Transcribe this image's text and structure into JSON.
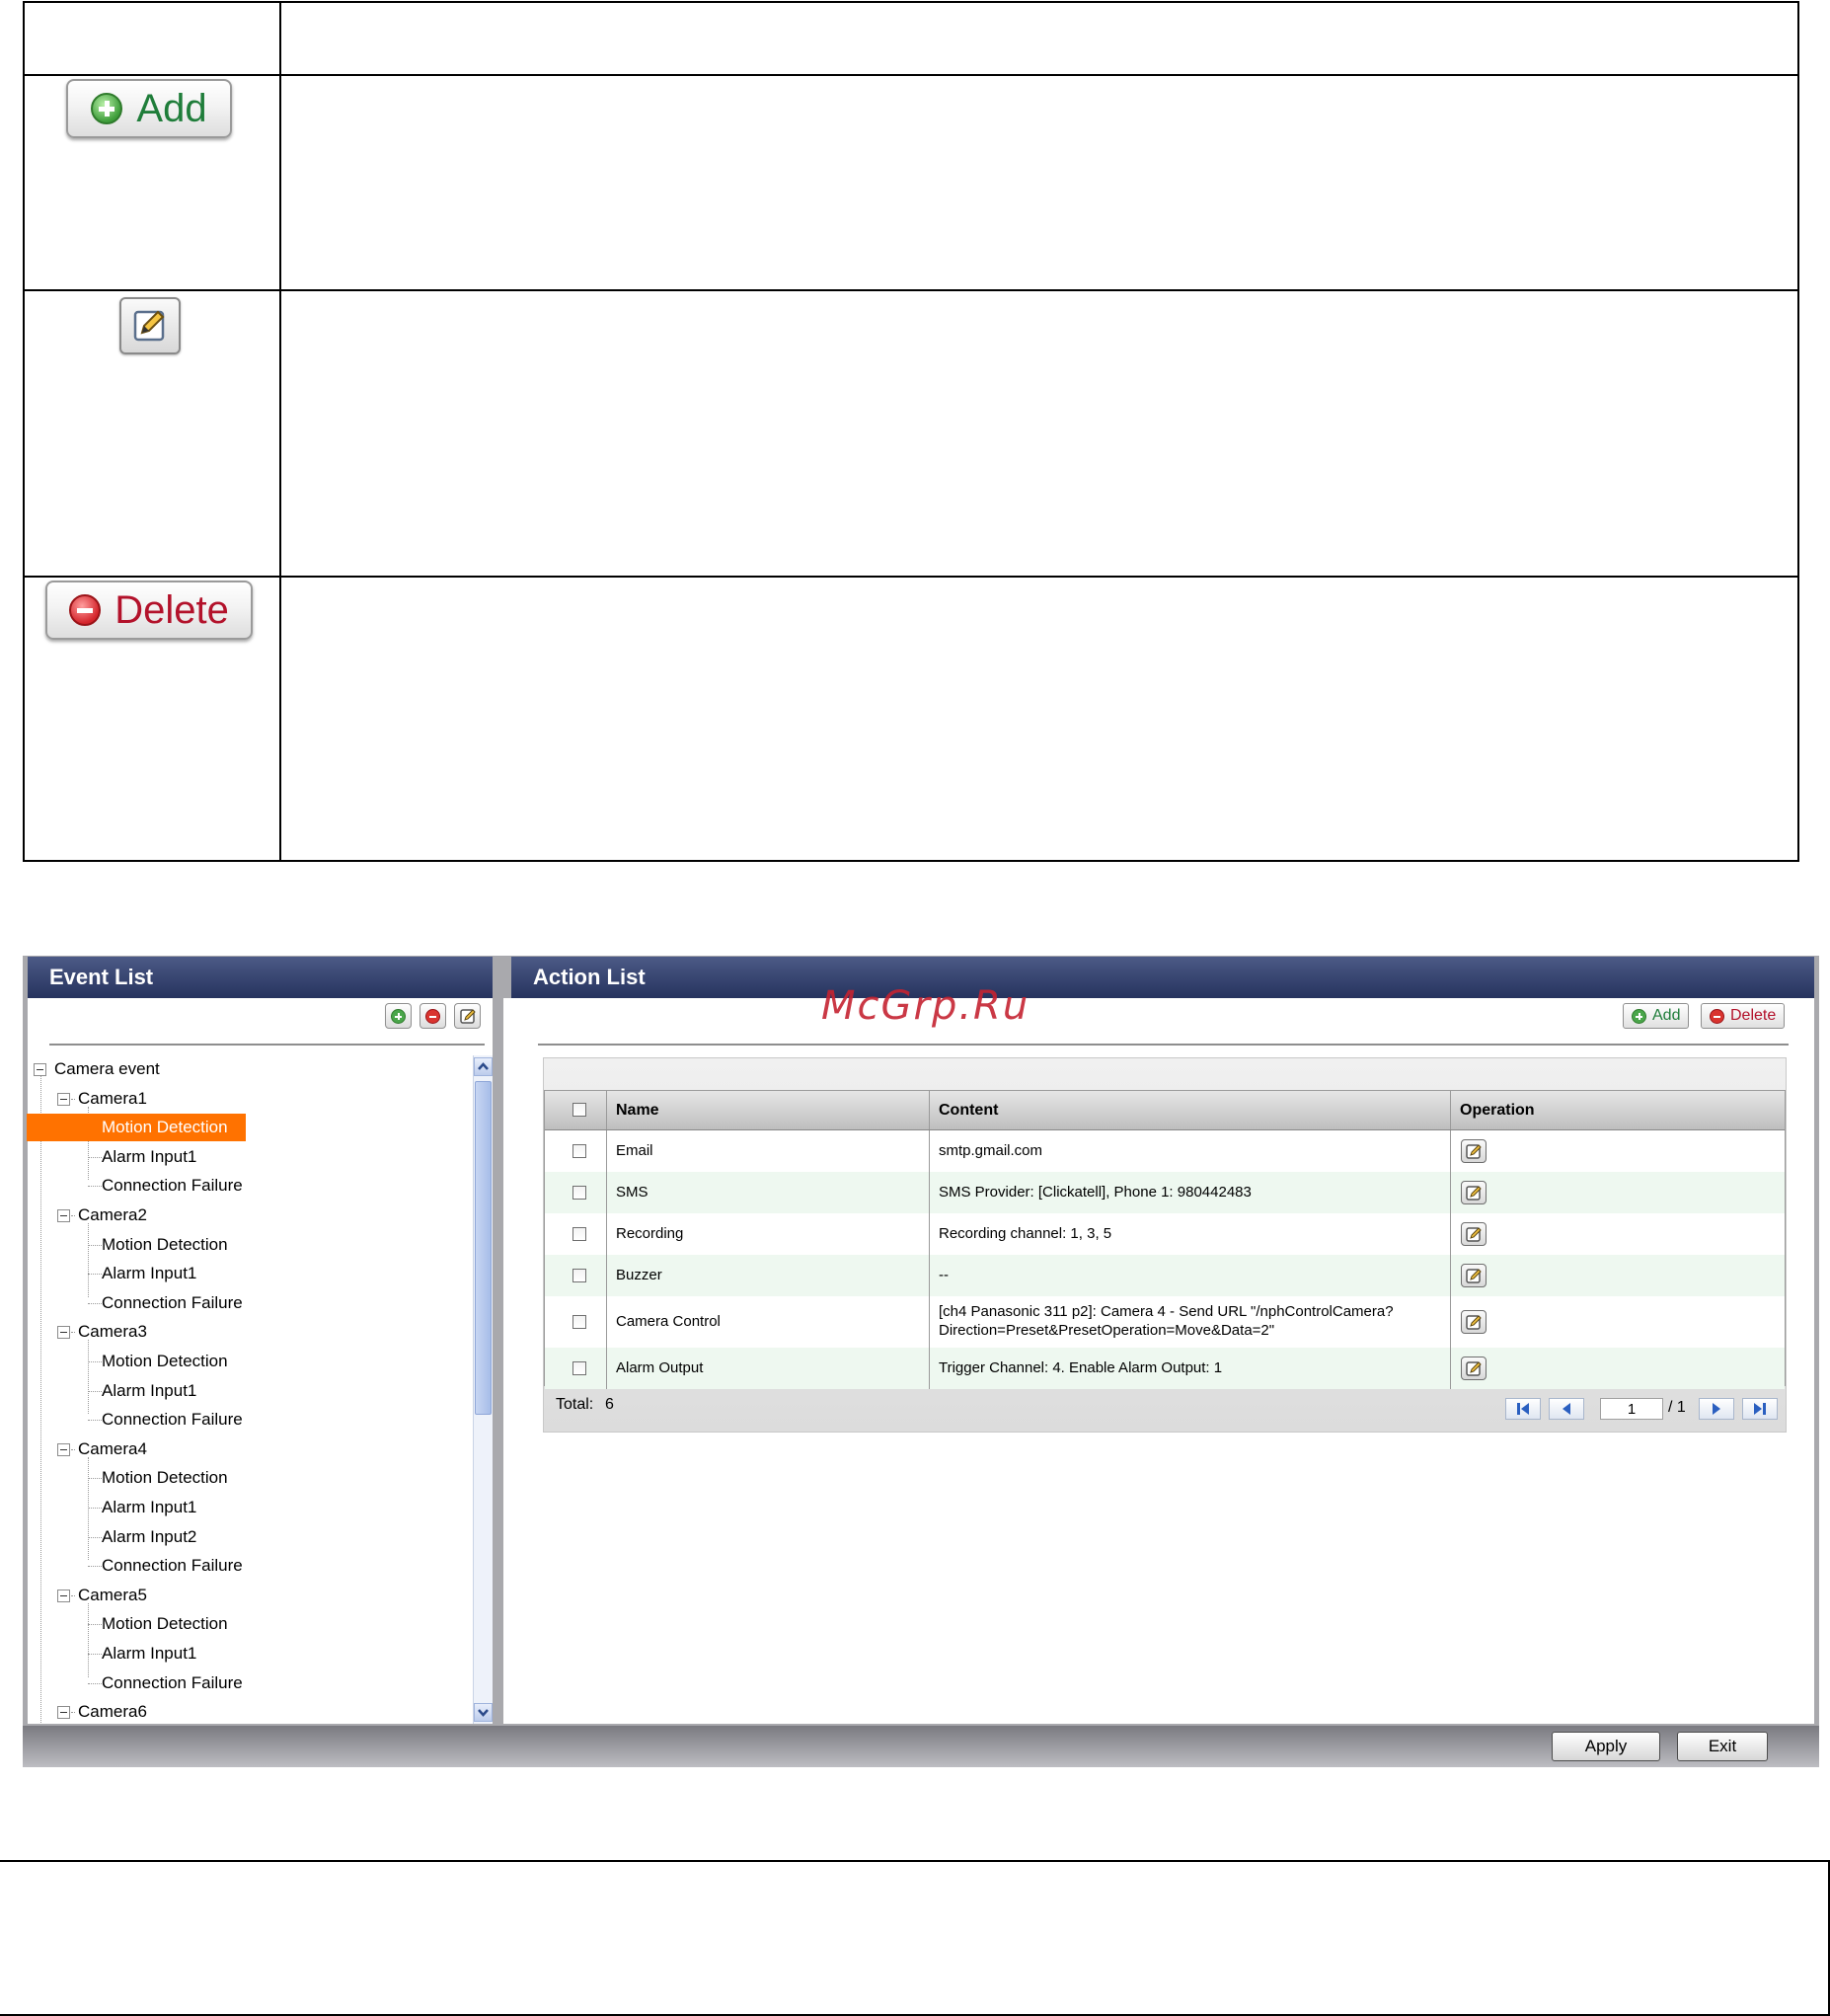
{
  "doc_table": {
    "add_button_label": "Add",
    "delete_button_label": "Delete"
  },
  "watermark": "McGrp.Ru",
  "event_list": {
    "title": "Event List",
    "tree": [
      {
        "label": "Camera event",
        "level": 0,
        "expander": true
      },
      {
        "label": "Camera1",
        "level": 1,
        "expander": true
      },
      {
        "label": "Motion Detection",
        "level": 2,
        "selected": true
      },
      {
        "label": "Alarm Input1",
        "level": 2
      },
      {
        "label": "Connection Failure",
        "level": 2
      },
      {
        "label": "Camera2",
        "level": 1,
        "expander": true
      },
      {
        "label": "Motion Detection",
        "level": 2
      },
      {
        "label": "Alarm Input1",
        "level": 2
      },
      {
        "label": "Connection Failure",
        "level": 2
      },
      {
        "label": "Camera3",
        "level": 1,
        "expander": true
      },
      {
        "label": "Motion Detection",
        "level": 2
      },
      {
        "label": "Alarm Input1",
        "level": 2
      },
      {
        "label": "Connection Failure",
        "level": 2
      },
      {
        "label": "Camera4",
        "level": 1,
        "expander": true
      },
      {
        "label": "Motion Detection",
        "level": 2
      },
      {
        "label": "Alarm Input1",
        "level": 2
      },
      {
        "label": "Alarm Input2",
        "level": 2
      },
      {
        "label": "Connection Failure",
        "level": 2
      },
      {
        "label": "Camera5",
        "level": 1,
        "expander": true
      },
      {
        "label": "Motion Detection",
        "level": 2
      },
      {
        "label": "Alarm Input1",
        "level": 2
      },
      {
        "label": "Connection Failure",
        "level": 2
      },
      {
        "label": "Camera6",
        "level": 1,
        "expander": true
      }
    ]
  },
  "action_list": {
    "title": "Action List",
    "add_label": "Add",
    "delete_label": "Delete",
    "columns": [
      "Name",
      "Content",
      "Operation"
    ],
    "rows": [
      {
        "name": "Email",
        "content": "smtp.gmail.com"
      },
      {
        "name": "SMS",
        "content": "SMS Provider: [Clickatell], Phone 1: 980442483"
      },
      {
        "name": "Recording",
        "content": "Recording channel: 1, 3, 5"
      },
      {
        "name": "Buzzer",
        "content": "--"
      },
      {
        "name": "Camera Control",
        "content": "[ch4 Panasonic 311 p2]: Camera 4 - Send URL \"/nphControlCamera?",
        "content2": "Direction=Preset&PresetOperation=Move&Data=2\""
      },
      {
        "name": "Alarm Output",
        "content": "Trigger Channel: 4. Enable Alarm Output: 1"
      }
    ],
    "total_label": "Total:",
    "total_value": "6",
    "page_current": "1",
    "page_total": "/ 1"
  },
  "bottom_bar": {
    "apply_label": "Apply",
    "exit_label": "Exit"
  }
}
